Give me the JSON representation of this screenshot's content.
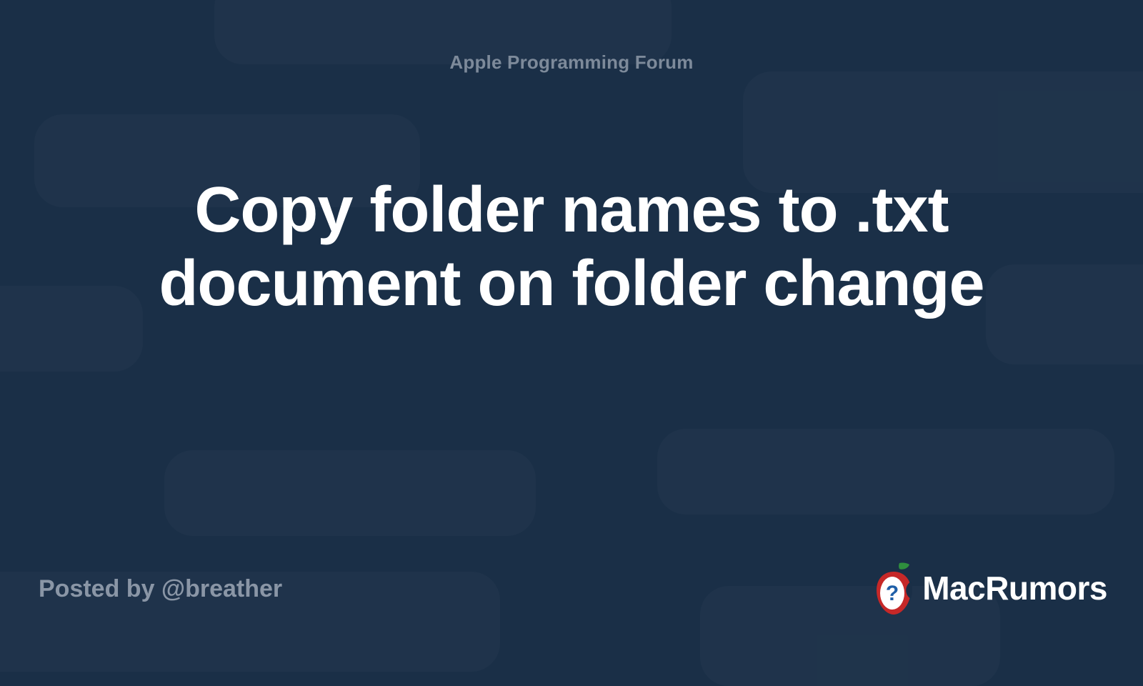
{
  "header": {
    "forum_label": "Apple Programming Forum"
  },
  "post": {
    "title": "Copy folder names to .txt document on folder change",
    "posted_by": "Posted by @breather"
  },
  "brand": {
    "name": "MacRumors"
  }
}
